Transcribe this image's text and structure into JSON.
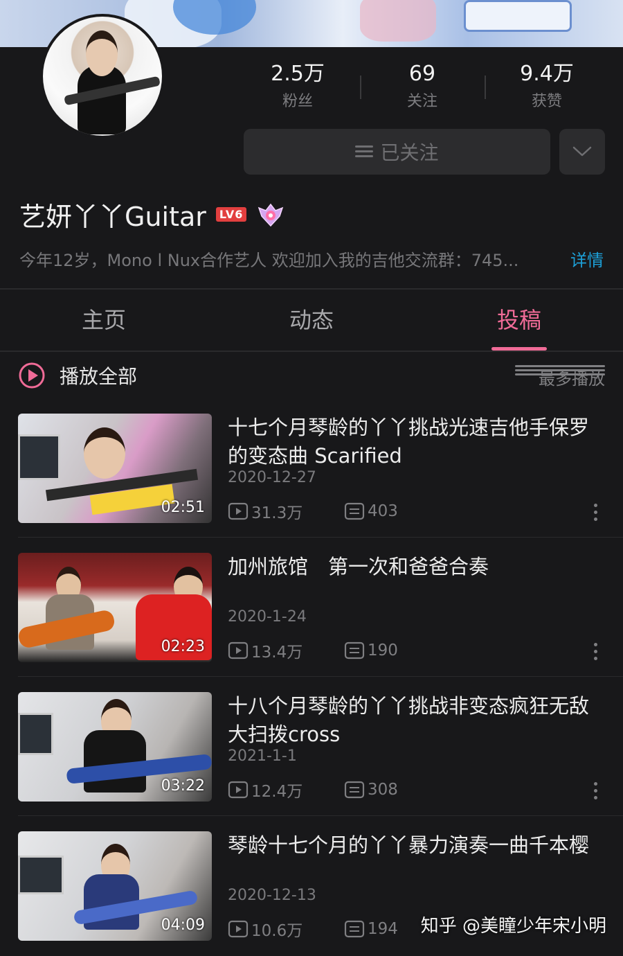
{
  "profile": {
    "name": "艺妍丫丫Guitar",
    "level": "LV6",
    "bio": "今年12岁，Mono l Nux合作艺人  欢迎加入我的吉他交流群：745...",
    "detail_link": "详情"
  },
  "stats": [
    {
      "value": "2.5万",
      "label": "粉丝"
    },
    {
      "value": "69",
      "label": "关注"
    },
    {
      "value": "9.4万",
      "label": "获赞"
    }
  ],
  "follow_button": {
    "label": "已关注",
    "icon": "menu-icon"
  },
  "tabs": [
    {
      "label": "主页",
      "active": false
    },
    {
      "label": "动态",
      "active": false
    },
    {
      "label": "投稿",
      "active": true
    }
  ],
  "list_header": {
    "play_all": "播放全部",
    "sort": "最多播放"
  },
  "videos": [
    {
      "title": "十七个月琴龄的丫丫挑战光速吉他手保罗的变态曲 Scarified",
      "date": "2020-12-27",
      "views": "31.3万",
      "comments": "403",
      "duration": "02:51"
    },
    {
      "title": "加州旅馆　第一次和爸爸合奏",
      "date": "2020-1-24",
      "views": "13.4万",
      "comments": "190",
      "duration": "02:23"
    },
    {
      "title": "十八个月琴龄的丫丫挑战非变态疯狂无敌大扫拨cross",
      "date": "2021-1-1",
      "views": "12.4万",
      "comments": "308",
      "duration": "03:22"
    },
    {
      "title": "琴龄十七个月的丫丫暴力演奏一曲千本樱",
      "date": "2020-12-13",
      "views": "10.6万",
      "comments": "194",
      "duration": "04:09"
    }
  ],
  "watermark": "知乎 @美瞳少年宋小明",
  "colors": {
    "accent": "#f06b97",
    "link": "#1da0d8",
    "background": "#18181a"
  }
}
